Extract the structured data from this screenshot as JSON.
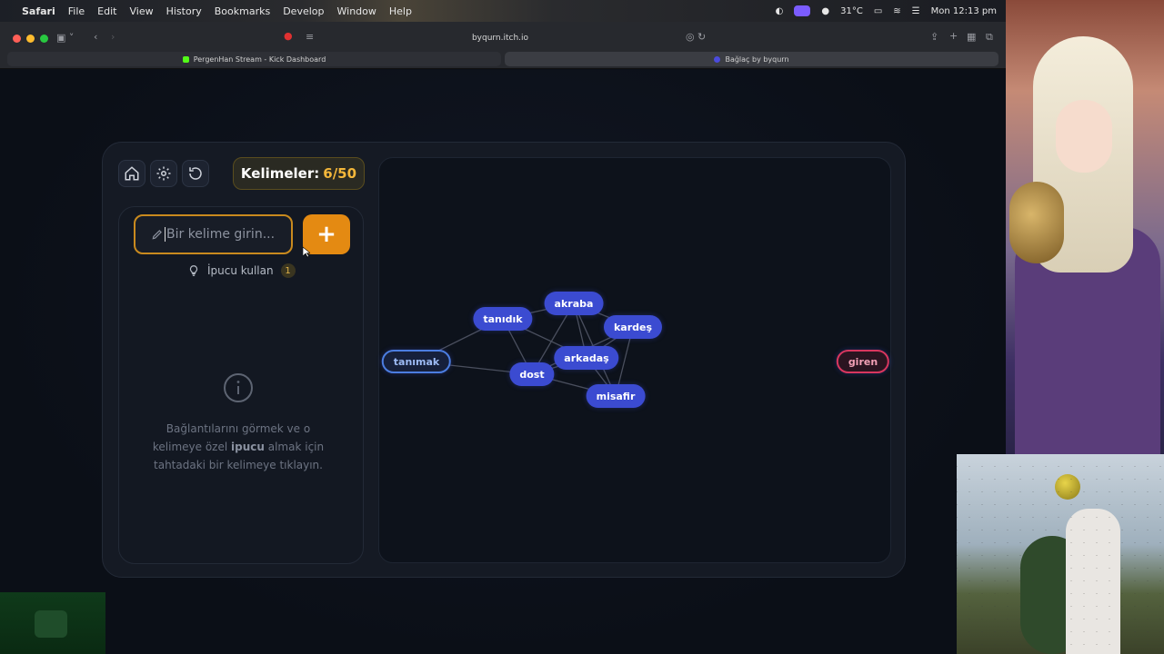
{
  "menubar": {
    "items": [
      "Safari",
      "File",
      "Edit",
      "View",
      "History",
      "Bookmarks",
      "Develop",
      "Window",
      "Help"
    ],
    "temperature": "31°C",
    "clock": "Mon 12:13 pm"
  },
  "browser": {
    "url": "byqurn.itch.io",
    "tabs": [
      {
        "label": "PergenHan Stream - Kick Dashboard",
        "favicon_color": "#53fc18"
      },
      {
        "label": "Bağlaç by byqurn",
        "favicon_color": "#4b4bdc"
      }
    ]
  },
  "game": {
    "counter_label": "Kelimeler:",
    "counter_value": "6/50",
    "input_placeholder": "Bir kelime girin...",
    "add_button": "+",
    "hint_label": "İpucu kullan",
    "hint_count": "1",
    "info_text_before": "Bağlantılarını görmek ve o kelimeye özel ",
    "info_text_bold": "ipucu",
    "info_text_after": " almak için tahtadaki bir kelimeye tıklayın.",
    "start_word": "tanımak",
    "target_word": "giren",
    "words": [
      "akraba",
      "tanıdık",
      "kardeş",
      "arkadaş",
      "dost",
      "misafir"
    ]
  },
  "colors": {
    "accent": "#e48a12",
    "node": "#3b4bd1",
    "start_border": "#4b7de0",
    "target_border": "#d8365e",
    "counter_value": "#f4b73a"
  }
}
